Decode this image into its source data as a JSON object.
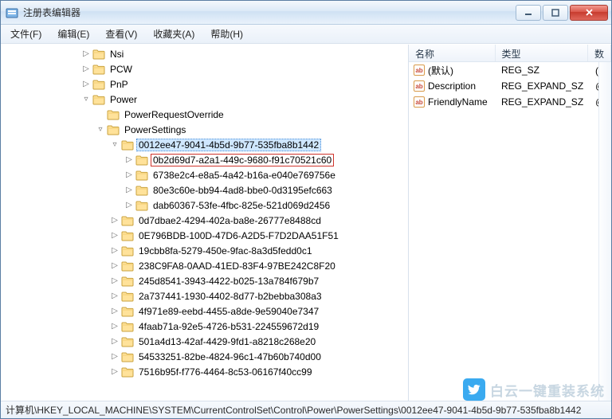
{
  "window": {
    "title": "注册表编辑器"
  },
  "menu": {
    "file": "文件(F)",
    "edit": "编辑(E)",
    "view": "查看(V)",
    "favorites": "收藏夹(A)",
    "help": "帮助(H)"
  },
  "tree": {
    "nodes": [
      {
        "indent": 1,
        "toggle": "▷",
        "label": "Nsi"
      },
      {
        "indent": 1,
        "toggle": "▷",
        "label": "PCW"
      },
      {
        "indent": 1,
        "toggle": "▷",
        "label": "PnP"
      },
      {
        "indent": 1,
        "toggle": "▿",
        "label": "Power"
      },
      {
        "indent": 2,
        "toggle": " ",
        "label": "PowerRequestOverride"
      },
      {
        "indent": 2,
        "toggle": "▿",
        "label": "PowerSettings"
      },
      {
        "indent": 3,
        "toggle": "▿",
        "label": "0012ee47-9041-4b5d-9b77-535fba8b1442",
        "selectedParent": true
      },
      {
        "indent": 4,
        "toggle": "▷",
        "label": "0b2d69d7-a2a1-449c-9680-f91c70521c60",
        "highlight": true
      },
      {
        "indent": 4,
        "toggle": "▷",
        "label": "6738e2c4-e8a5-4a42-b16a-e040e769756e"
      },
      {
        "indent": 4,
        "toggle": "▷",
        "label": "80e3c60e-bb94-4ad8-bbe0-0d3195efc663"
      },
      {
        "indent": 4,
        "toggle": "▷",
        "label": "dab60367-53fe-4fbc-825e-521d069d2456"
      },
      {
        "indent": 3,
        "toggle": "▷",
        "label": "0d7dbae2-4294-402a-ba8e-26777e8488cd"
      },
      {
        "indent": 3,
        "toggle": "▷",
        "label": "0E796BDB-100D-47D6-A2D5-F7D2DAA51F51"
      },
      {
        "indent": 3,
        "toggle": "▷",
        "label": "19cbb8fa-5279-450e-9fac-8a3d5fedd0c1"
      },
      {
        "indent": 3,
        "toggle": "▷",
        "label": "238C9FA8-0AAD-41ED-83F4-97BE242C8F20"
      },
      {
        "indent": 3,
        "toggle": "▷",
        "label": "245d8541-3943-4422-b025-13a784f679b7"
      },
      {
        "indent": 3,
        "toggle": "▷",
        "label": "2a737441-1930-4402-8d77-b2bebba308a3"
      },
      {
        "indent": 3,
        "toggle": "▷",
        "label": "4f971e89-eebd-4455-a8de-9e59040e7347"
      },
      {
        "indent": 3,
        "toggle": "▷",
        "label": "4faab71a-92e5-4726-b531-224559672d19"
      },
      {
        "indent": 3,
        "toggle": "▷",
        "label": "501a4d13-42af-4429-9fd1-a8218c268e20"
      },
      {
        "indent": 3,
        "toggle": "▷",
        "label": "54533251-82be-4824-96c1-47b60b740d00"
      },
      {
        "indent": 3,
        "toggle": "▷",
        "label": "7516b95f-f776-4464-8c53-06167f40cc99"
      }
    ]
  },
  "list": {
    "columns": {
      "name": "名称",
      "type": "类型",
      "data": "数"
    },
    "rows": [
      {
        "name": "(默认)",
        "type": "REG_SZ",
        "data": "(数"
      },
      {
        "name": "Description",
        "type": "REG_EXPAND_SZ",
        "data": "@"
      },
      {
        "name": "FriendlyName",
        "type": "REG_EXPAND_SZ",
        "data": "@"
      }
    ]
  },
  "statusbar": {
    "path": "计算机\\HKEY_LOCAL_MACHINE\\SYSTEM\\CurrentControlSet\\Control\\Power\\PowerSettings\\0012ee47-9041-4b5d-9b77-535fba8b1442"
  },
  "watermark": {
    "text": "白云一键重装系统"
  }
}
